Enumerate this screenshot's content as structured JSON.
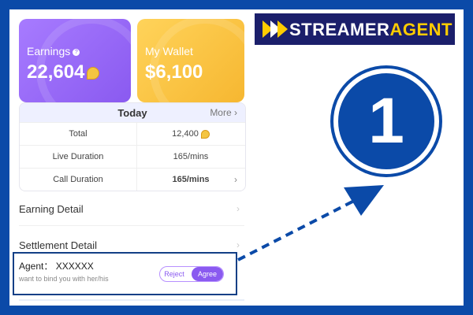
{
  "cards": {
    "earnings": {
      "title": "Earnings",
      "value": "22,604"
    },
    "wallet": {
      "title": "My Wallet",
      "value": "$6,100"
    }
  },
  "today": {
    "title": "Today",
    "more": "More",
    "rows": [
      {
        "label": "Total",
        "value": "12,400"
      },
      {
        "label": "Live Duration",
        "value": "165/mins"
      },
      {
        "label": "Call Duration",
        "value": "165/mins"
      }
    ]
  },
  "links": {
    "earning_detail": "Earning Detail",
    "settlement_detail": "Settlement Detail"
  },
  "agent": {
    "name": "Agent： XXXXXX",
    "subtitle": "want to bind you with her/his",
    "reject": "Reject",
    "agree": "Agree"
  },
  "brand": {
    "text_white": "STREAMER",
    "text_yellow": "AGENT"
  },
  "badge": {
    "number": "1"
  },
  "colors": {
    "frame": "#0b4aa8",
    "purple": "#8a5af0",
    "gold": "#f6b731",
    "brand_bg": "#1b1f6b",
    "brand_yellow": "#ffcc00"
  }
}
